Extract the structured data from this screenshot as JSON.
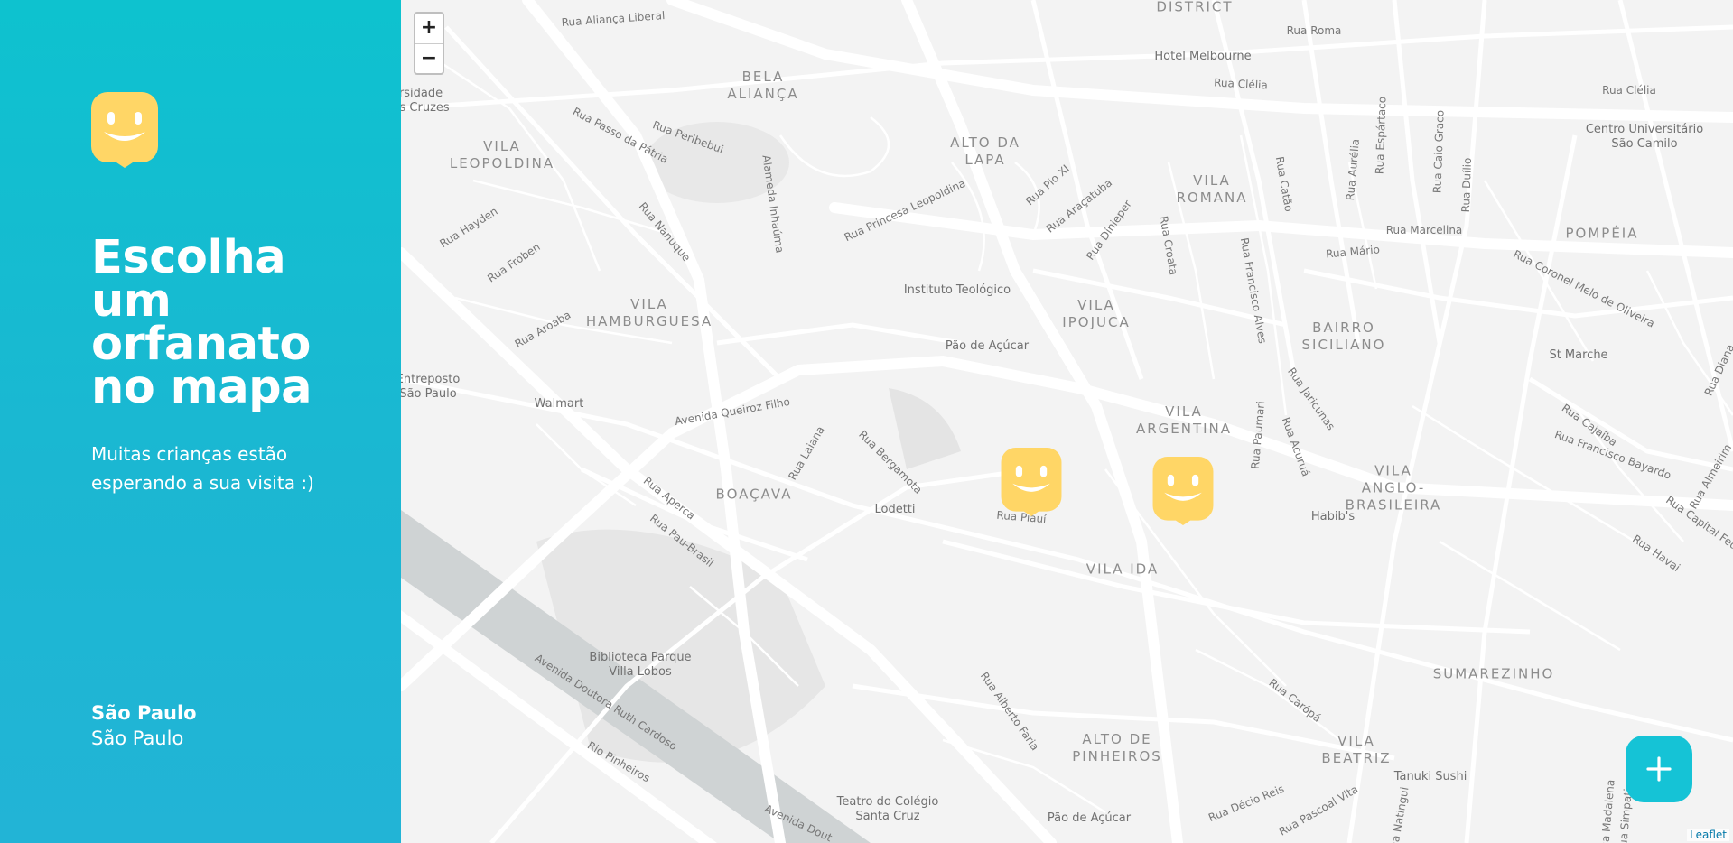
{
  "sidebar": {
    "logo_icon": "happy-map-marker-icon",
    "headline_lines": [
      "Escolha",
      "um",
      "orfanato",
      "no mapa"
    ],
    "subtitle_lines": [
      "Muitas crianças estão",
      "esperando a sua visita :)"
    ],
    "location": {
      "city": "São Paulo",
      "state": "São Paulo"
    },
    "colors": {
      "gradient_top": "#0ec2cf",
      "gradient_bottom": "#22b4d6",
      "marker": "#ffd666"
    }
  },
  "map": {
    "zoom_in_label": "+",
    "zoom_out_label": "−",
    "attribution": "Leaflet",
    "marker_icon": "orphanage-marker-icon",
    "markers_count_shown": 2,
    "add_button_icon": "plus-icon",
    "districts": [
      {
        "text": "DISTRICT"
      },
      {
        "text": "BELA\nALIANÇA"
      },
      {
        "text": "VILA\nLEOPOLDINA"
      },
      {
        "text": "ALTO DA\nLAPA"
      },
      {
        "text": "VILA\nROMANA"
      },
      {
        "text": "POMPÉIA"
      },
      {
        "text": "VILA\nHAMBURGUESA"
      },
      {
        "text": "VILA\nIPOJUCA"
      },
      {
        "text": "BAIRRO\nSICILIANO"
      },
      {
        "text": "VILA\nARGENTINA"
      },
      {
        "text": "VILA\nANGLO-\nBRASILEIRA"
      },
      {
        "text": "BOAÇAVA"
      },
      {
        "text": "VILA IDA"
      },
      {
        "text": "SUMAREZINHO"
      },
      {
        "text": "ALTO DE\nPINHEIROS"
      },
      {
        "text": "VILA\nBEATRIZ"
      }
    ],
    "pois": [
      {
        "text": "Hotel Melbourne"
      },
      {
        "text": "Centro Universitário\nSão Camilo"
      },
      {
        "text": "Instituto Teológico"
      },
      {
        "text": "Pão de Açúcar"
      },
      {
        "text": "St Marche"
      },
      {
        "text": "Walmart"
      },
      {
        "text": "Entreposto\nSão Paulo"
      },
      {
        "text": "Lodetti"
      },
      {
        "text": "Habib's"
      },
      {
        "text": "Biblioteca Parque\nVilla Lobos"
      },
      {
        "text": "Teatro do Colégio\nSanta Cruz"
      },
      {
        "text": "Pão de Açúcar"
      },
      {
        "text": "Tanuki Sushi"
      },
      {
        "text": "ersidade\ndas Cruzes"
      }
    ],
    "roads": [
      {
        "text": "Rua Aliança Liberal"
      },
      {
        "text": "Rua Roma"
      },
      {
        "text": "Rua Clélia"
      },
      {
        "text": "Rua Clélia"
      },
      {
        "text": "Rua Passo da Pátria"
      },
      {
        "text": "Rua Peribebui"
      },
      {
        "text": "Alameda Inhaúma"
      },
      {
        "text": "Rua Princesa Leopoldina"
      },
      {
        "text": "Rua Pio XI"
      },
      {
        "text": "Rua Araçatuba"
      },
      {
        "text": "Rua Dínieper"
      },
      {
        "text": "Rua Croata"
      },
      {
        "text": "Rua Catão"
      },
      {
        "text": "Rua Aurélia"
      },
      {
        "text": "Rua Espártaco"
      },
      {
        "text": "Rua Caio Graco"
      },
      {
        "text": "Rua Duílio"
      },
      {
        "text": "Rua Marcelina"
      },
      {
        "text": "Rua Mário"
      },
      {
        "text": "Rua Coronel Melo de Oliveira"
      },
      {
        "text": "Rua Hayden"
      },
      {
        "text": "Rua Froben"
      },
      {
        "text": "Rua Nanuque"
      },
      {
        "text": "Rua Aroaba"
      },
      {
        "text": "Rua Francisco Alves"
      },
      {
        "text": "Rua Jaricunas"
      },
      {
        "text": "Avenida Queiroz Filho"
      },
      {
        "text": "Rua Laiana"
      },
      {
        "text": "Rua Bergamota"
      },
      {
        "text": "Rua Paumari"
      },
      {
        "text": "Rua Acuruá"
      },
      {
        "text": "Rua Cajaíba"
      },
      {
        "text": "Rua Francisco Bayardo"
      },
      {
        "text": "Rua Capital Federal"
      },
      {
        "text": "Rua Havai"
      },
      {
        "text": "Rua Almeirim"
      },
      {
        "text": "Rua Diana"
      },
      {
        "text": "Rua Aperca"
      },
      {
        "text": "Rua Pau-Brasil"
      },
      {
        "text": "Rua Piauí"
      },
      {
        "text": "Avenida Doutora Ruth Cardoso"
      },
      {
        "text": "Rio Pinheiros"
      },
      {
        "text": "Rua Alberto Faria"
      },
      {
        "text": "Rua Carópá"
      },
      {
        "text": "Rua Décio Reis"
      },
      {
        "text": "Rua Pascoal Vita"
      },
      {
        "text": "Avenida Dout"
      },
      {
        "text": "Rua Natingui"
      },
      {
        "text": "Rua Madalena"
      },
      {
        "text": "Rua Simpatia"
      }
    ]
  }
}
